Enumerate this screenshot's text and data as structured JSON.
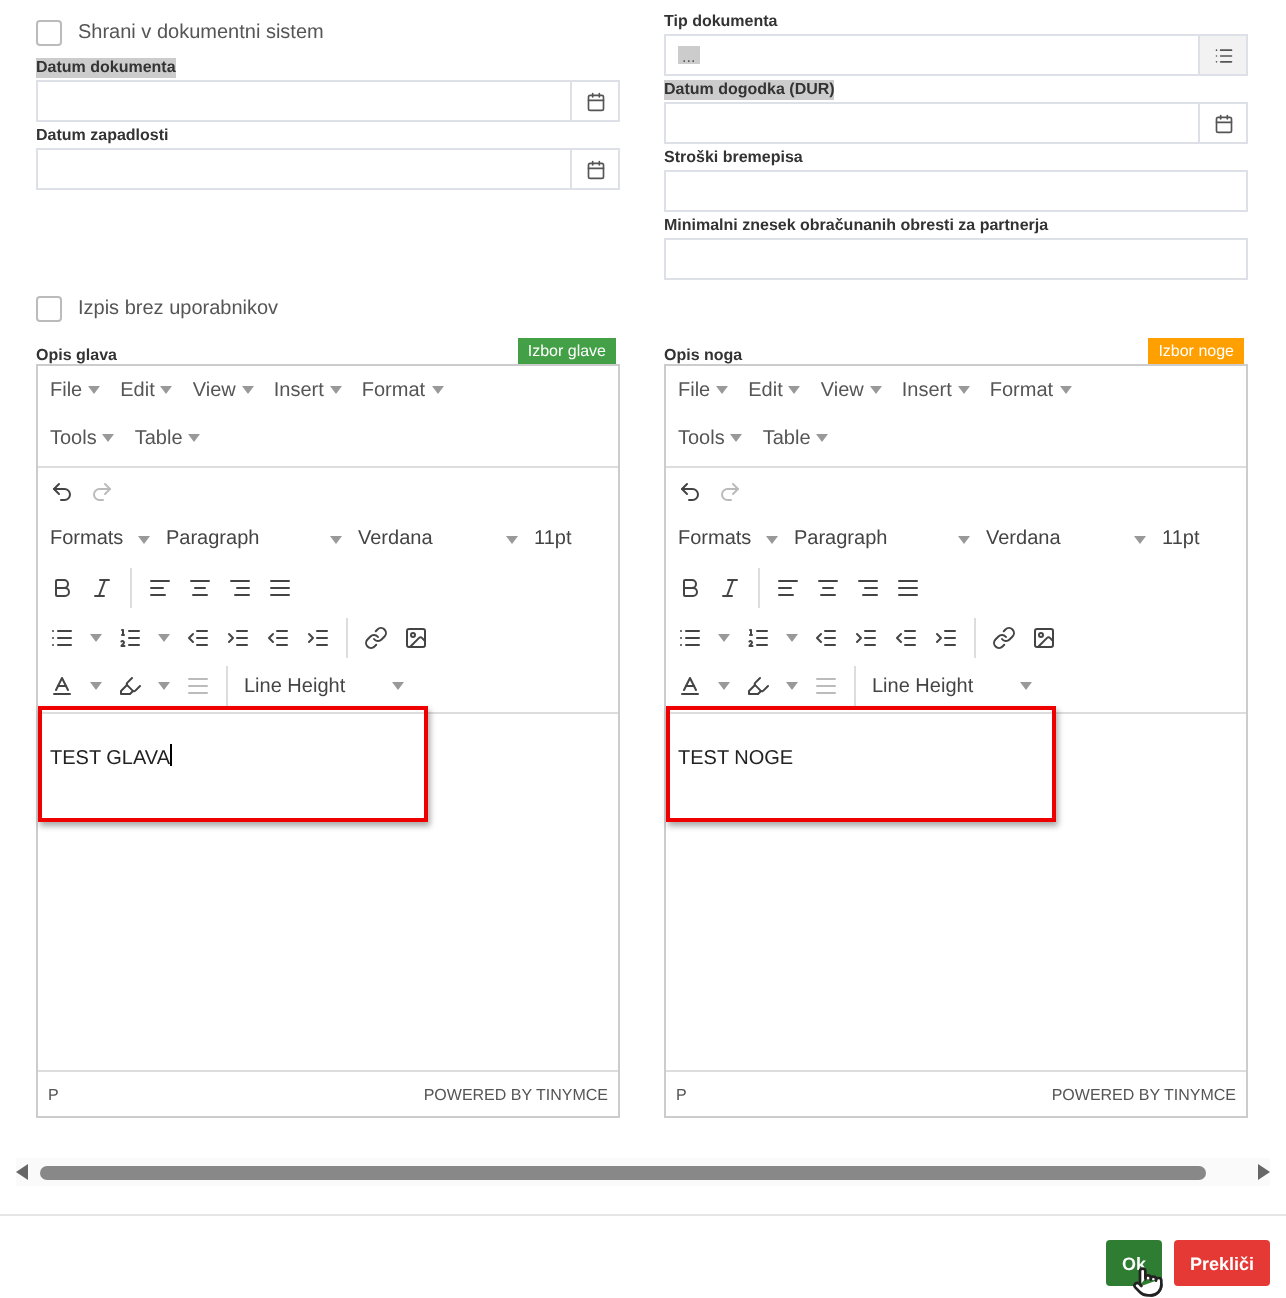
{
  "left_column": {
    "checkbox": {
      "label": "Shrani v dokumentni sistem",
      "checked": false
    },
    "fields": [
      {
        "label": "Datum dokumenta",
        "kind": "date",
        "highlighted": true
      },
      {
        "label": "Datum zapadlosti",
        "kind": "date",
        "highlighted": false
      }
    ]
  },
  "right_column": {
    "fields": [
      {
        "label": "Tip dokumenta",
        "kind": "list",
        "value": "...",
        "highlighted": false
      },
      {
        "label": "Datum dogodka (DUR)",
        "kind": "date",
        "highlighted": true
      },
      {
        "label": "Stroški bremepisa",
        "kind": "text",
        "highlighted": false
      },
      {
        "label": "Minimalni znesek obračunanih obresti za partnerja",
        "kind": "text",
        "highlighted": false
      }
    ]
  },
  "checkbox": {
    "label": "Izpis brez uporabnikov",
    "checked": false
  },
  "editors": [
    {
      "label": "Opis glava",
      "button": {
        "label": "Izbor glave",
        "color": "#43a047"
      },
      "menu": [
        "File",
        "Edit",
        "View",
        "Insert",
        "Format"
      ],
      "menu2": [
        "Tools",
        "Table"
      ],
      "formats": "Formats",
      "block": "Paragraph",
      "font": "Verdana",
      "size": "11pt",
      "line_height": "Line Height",
      "content": "TEST GLAVA",
      "focused": true,
      "path": "P",
      "branding": "POWERED BY TINYMCE"
    },
    {
      "label": "Opis noga",
      "button": {
        "label": "Izbor noge",
        "color": "#ffa000"
      },
      "menu": [
        "File",
        "Edit",
        "View",
        "Insert",
        "Format"
      ],
      "menu2": [
        "Tools",
        "Table"
      ],
      "formats": "Formats",
      "block": "Paragraph",
      "font": "Verdana",
      "size": "11pt",
      "line_height": "Line Height",
      "content": "TEST NOGE",
      "focused": false,
      "path": "P",
      "branding": "POWERED BY TINYMCE"
    }
  ],
  "buttons": [
    {
      "label": "Ok",
      "kind": "primary"
    },
    {
      "label": "Prekliči",
      "kind": "danger"
    }
  ]
}
